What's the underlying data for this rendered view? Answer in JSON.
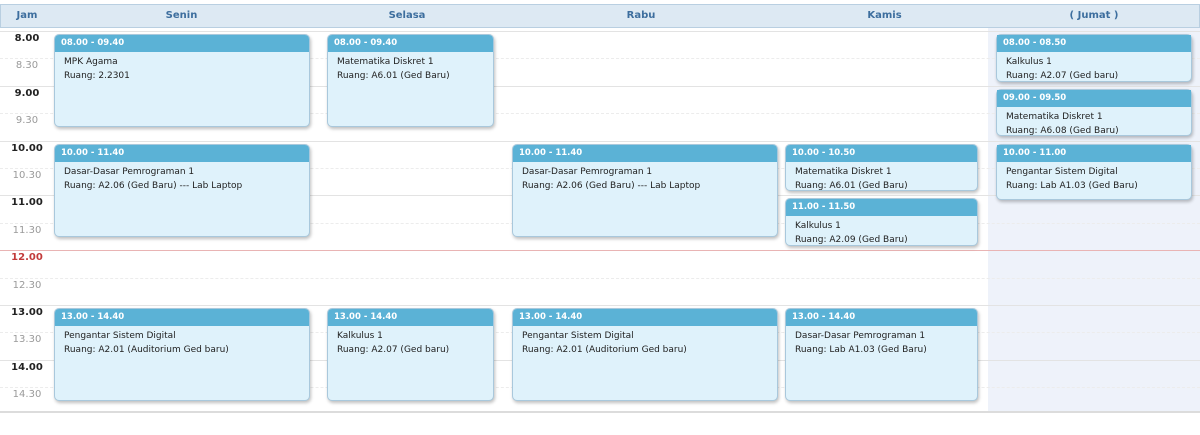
{
  "header": {
    "jam": "Jam",
    "days": [
      "Senin",
      "Selasa",
      "Rabu",
      "Kamis",
      "( Jumat )"
    ]
  },
  "time_labels": [
    "8.00",
    "8.30",
    "9.00",
    "9.30",
    "10.00",
    "10.30",
    "11.00",
    "11.30",
    "12.00",
    "12.30",
    "13.00",
    "13.30",
    "14.00",
    "14.30"
  ],
  "events": [
    {
      "day": 0,
      "start": 8.0,
      "end": 9.6667,
      "time": "08.00 - 09.40",
      "title": "MPK Agama",
      "room": "Ruang: 2.2301"
    },
    {
      "day": 1,
      "start": 8.0,
      "end": 9.6667,
      "time": "08.00 - 09.40",
      "title": "Matematika Diskret 1",
      "room": "Ruang: A6.01 (Ged Baru)"
    },
    {
      "day": 4,
      "start": 8.0,
      "end": 8.8333,
      "time": "08.00 - 08.50",
      "title": "Kalkulus 1",
      "room": "Ruang: A2.07 (Ged baru)"
    },
    {
      "day": 4,
      "start": 9.0,
      "end": 9.8333,
      "time": "09.00 - 09.50",
      "title": "Matematika Diskret 1",
      "room": "Ruang: A6.08 (Ged Baru)"
    },
    {
      "day": 4,
      "start": 10.0,
      "end": 11.0,
      "time": "10.00 - 11.00",
      "title": "Pengantar Sistem Digital",
      "room": "Ruang: Lab A1.03 (Ged Baru)"
    },
    {
      "day": 0,
      "start": 10.0,
      "end": 11.6667,
      "time": "10.00 - 11.40",
      "title": "Dasar-Dasar Pemrograman 1",
      "room": "Ruang: A2.06 (Ged Baru) --- Lab Laptop"
    },
    {
      "day": 2,
      "start": 10.0,
      "end": 11.6667,
      "time": "10.00 - 11.40",
      "title": "Dasar-Dasar Pemrograman 1",
      "room": "Ruang: A2.06 (Ged Baru) --- Lab Laptop"
    },
    {
      "day": 3,
      "start": 10.0,
      "end": 10.8333,
      "time": "10.00 - 10.50",
      "title": "Matematika Diskret 1",
      "room": "Ruang: A6.01 (Ged Baru)"
    },
    {
      "day": 3,
      "start": 11.0,
      "end": 11.8333,
      "time": "11.00 - 11.50",
      "title": "Kalkulus 1",
      "room": "Ruang: A2.09 (Ged Baru)"
    },
    {
      "day": 0,
      "start": 13.0,
      "end": 14.6667,
      "time": "13.00 - 14.40",
      "title": "Pengantar Sistem Digital",
      "room": "Ruang: A2.01 (Auditorium Ged baru)"
    },
    {
      "day": 1,
      "start": 13.0,
      "end": 14.6667,
      "time": "13.00 - 14.40",
      "title": "Kalkulus 1",
      "room": "Ruang: A2.07 (Ged baru)"
    },
    {
      "day": 2,
      "start": 13.0,
      "end": 14.6667,
      "time": "13.00 - 14.40",
      "title": "Pengantar Sistem Digital",
      "room": "Ruang: A2.01 (Auditorium Ged baru)"
    },
    {
      "day": 3,
      "start": 13.0,
      "end": 14.6667,
      "time": "13.00 - 14.40",
      "title": "Dasar-Dasar Pemrograman 1",
      "room": "Ruang: Lab A1.03 (Ged Baru)"
    }
  ]
}
